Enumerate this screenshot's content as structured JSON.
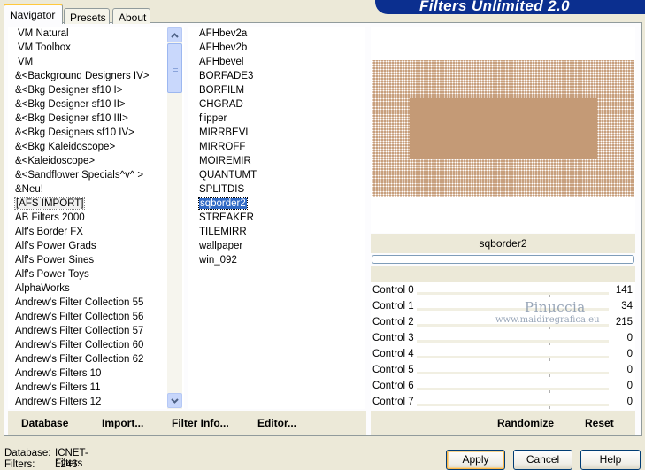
{
  "banner": {
    "title": "Filters Unlimited 2.0"
  },
  "tabs": {
    "navigator": "Navigator",
    "presets": "Presets",
    "about": "About"
  },
  "categories": [
    "VM Natural",
    "VM Toolbox",
    "VM",
    "&<Background Designers IV>",
    "&<Bkg Designer sf10 I>",
    "&<Bkg Designer sf10 II>",
    "&<Bkg Designer sf10 III>",
    "&<Bkg Designers sf10 IV>",
    "&<Bkg Kaleidoscope>",
    "&<Kaleidoscope>",
    "&<Sandflower Specials^v^ >",
    "&Neu!",
    "[AFS IMPORT]",
    "AB Filters 2000",
    "Alf's Border FX",
    "Alf's Power Grads",
    "Alf's Power Sines",
    "Alf's Power Toys",
    "AlphaWorks",
    "Andrew's Filter Collection 55",
    "Andrew's Filter Collection 56",
    "Andrew's Filter Collection 57",
    "Andrew's Filter Collection 60",
    "Andrew's Filter Collection 62",
    "Andrew's Filters 10",
    "Andrew's Filters 11",
    "Andrew's Filters 12"
  ],
  "selected_category": "[AFS IMPORT]",
  "filters": [
    "AFHbev2a",
    "AFHbev2b",
    "AFHbevel",
    "BORFADE3",
    "BORFILM",
    "CHGRAD",
    "flipper",
    "MIRRBEVL",
    "MIRROFF",
    "MOIREMIR",
    "QUANTUMT",
    "SPLITDIS",
    "sqborder2",
    "STREAKER",
    "TILEMIRR",
    "wallpaper",
    "win_092"
  ],
  "selected_filter": "sqborder2",
  "preview": {
    "filter_name": "sqborder2",
    "color": "#c49a76"
  },
  "controls": [
    {
      "label": "Control 0",
      "value": "141"
    },
    {
      "label": "Control 1",
      "value": "34"
    },
    {
      "label": "Control 2",
      "value": "215"
    },
    {
      "label": "Control 3",
      "value": "0"
    },
    {
      "label": "Control 4",
      "value": "0"
    },
    {
      "label": "Control 5",
      "value": "0"
    },
    {
      "label": "Control 6",
      "value": "0"
    },
    {
      "label": "Control 7",
      "value": "0"
    }
  ],
  "watermark": {
    "name": "Pinuccia",
    "site": "www.maidiregrafica.eu"
  },
  "left_buttons": {
    "database": "Database",
    "import": "Import...",
    "filter_info": "Filter Info...",
    "editor": "Editor..."
  },
  "right_buttons": {
    "randomize": "Randomize",
    "reset": "Reset"
  },
  "status": {
    "database_key": "Database:",
    "database_value": "ICNET-Filters",
    "filters_key": "Filters:",
    "filters_value": "1246"
  },
  "dialog_buttons": {
    "apply": "Apply",
    "cancel": "Cancel",
    "help": "Help"
  },
  "colors": {
    "banner": "#0b2f8f",
    "selection": "#316ac5",
    "tab_highlight": "#ffc83c"
  }
}
